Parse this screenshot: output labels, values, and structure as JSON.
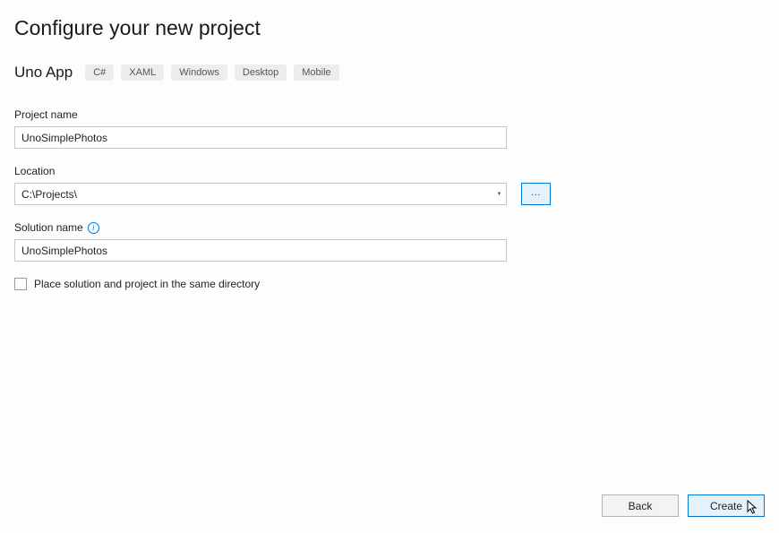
{
  "title": "Configure your new project",
  "template": {
    "name": "Uno App",
    "tags": [
      "C#",
      "XAML",
      "Windows",
      "Desktop",
      "Mobile"
    ]
  },
  "fields": {
    "project_name": {
      "label": "Project name",
      "value": "UnoSimplePhotos"
    },
    "location": {
      "label": "Location",
      "value": "C:\\Projects\\",
      "browse": "..."
    },
    "solution_name": {
      "label": "Solution name",
      "value": "UnoSimplePhotos"
    },
    "same_directory": {
      "label": "Place solution and project in the same directory",
      "checked": false
    }
  },
  "buttons": {
    "back": "Back",
    "create": "Create"
  }
}
